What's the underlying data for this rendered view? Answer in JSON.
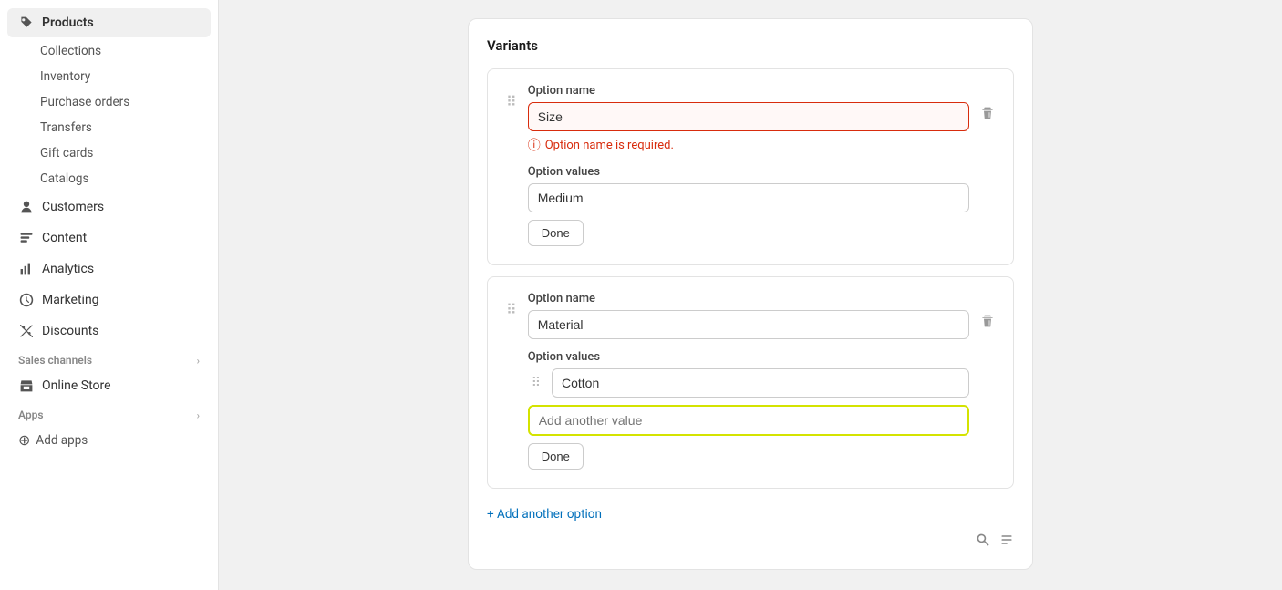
{
  "sidebar": {
    "items": [
      {
        "id": "products",
        "label": "Products",
        "icon": "tag",
        "active": true
      },
      {
        "id": "collections",
        "label": "Collections",
        "sub": true
      },
      {
        "id": "inventory",
        "label": "Inventory",
        "sub": true
      },
      {
        "id": "purchase-orders",
        "label": "Purchase orders",
        "sub": true
      },
      {
        "id": "transfers",
        "label": "Transfers",
        "sub": true
      },
      {
        "id": "gift-cards",
        "label": "Gift cards",
        "sub": true
      },
      {
        "id": "catalogs",
        "label": "Catalogs",
        "sub": true
      },
      {
        "id": "customers",
        "label": "Customers",
        "icon": "person"
      },
      {
        "id": "content",
        "label": "Content",
        "icon": "content"
      },
      {
        "id": "analytics",
        "label": "Analytics",
        "icon": "analytics"
      },
      {
        "id": "marketing",
        "label": "Marketing",
        "icon": "marketing"
      },
      {
        "id": "discounts",
        "label": "Discounts",
        "icon": "discounts"
      }
    ],
    "sections": [
      {
        "id": "sales-channels",
        "label": "Sales channels",
        "items": [
          {
            "id": "online-store",
            "label": "Online Store",
            "icon": "store"
          }
        ]
      },
      {
        "id": "apps",
        "label": "Apps",
        "items": []
      }
    ],
    "add_apps_label": "Add apps"
  },
  "main": {
    "variants_title": "Variants",
    "option1": {
      "name_label": "Option name",
      "name_value": "Size",
      "name_placeholder": "Size",
      "error_message": "Option name is required.",
      "values_label": "Option values",
      "values": [
        "Medium"
      ],
      "done_label": "Done"
    },
    "option2": {
      "name_label": "Option name",
      "name_value": "Material",
      "name_placeholder": "Material",
      "values_label": "Option values",
      "values": [
        "Cotton"
      ],
      "add_another_placeholder": "Add another value",
      "done_label": "Done"
    },
    "add_option_label": "+ Add another option"
  }
}
